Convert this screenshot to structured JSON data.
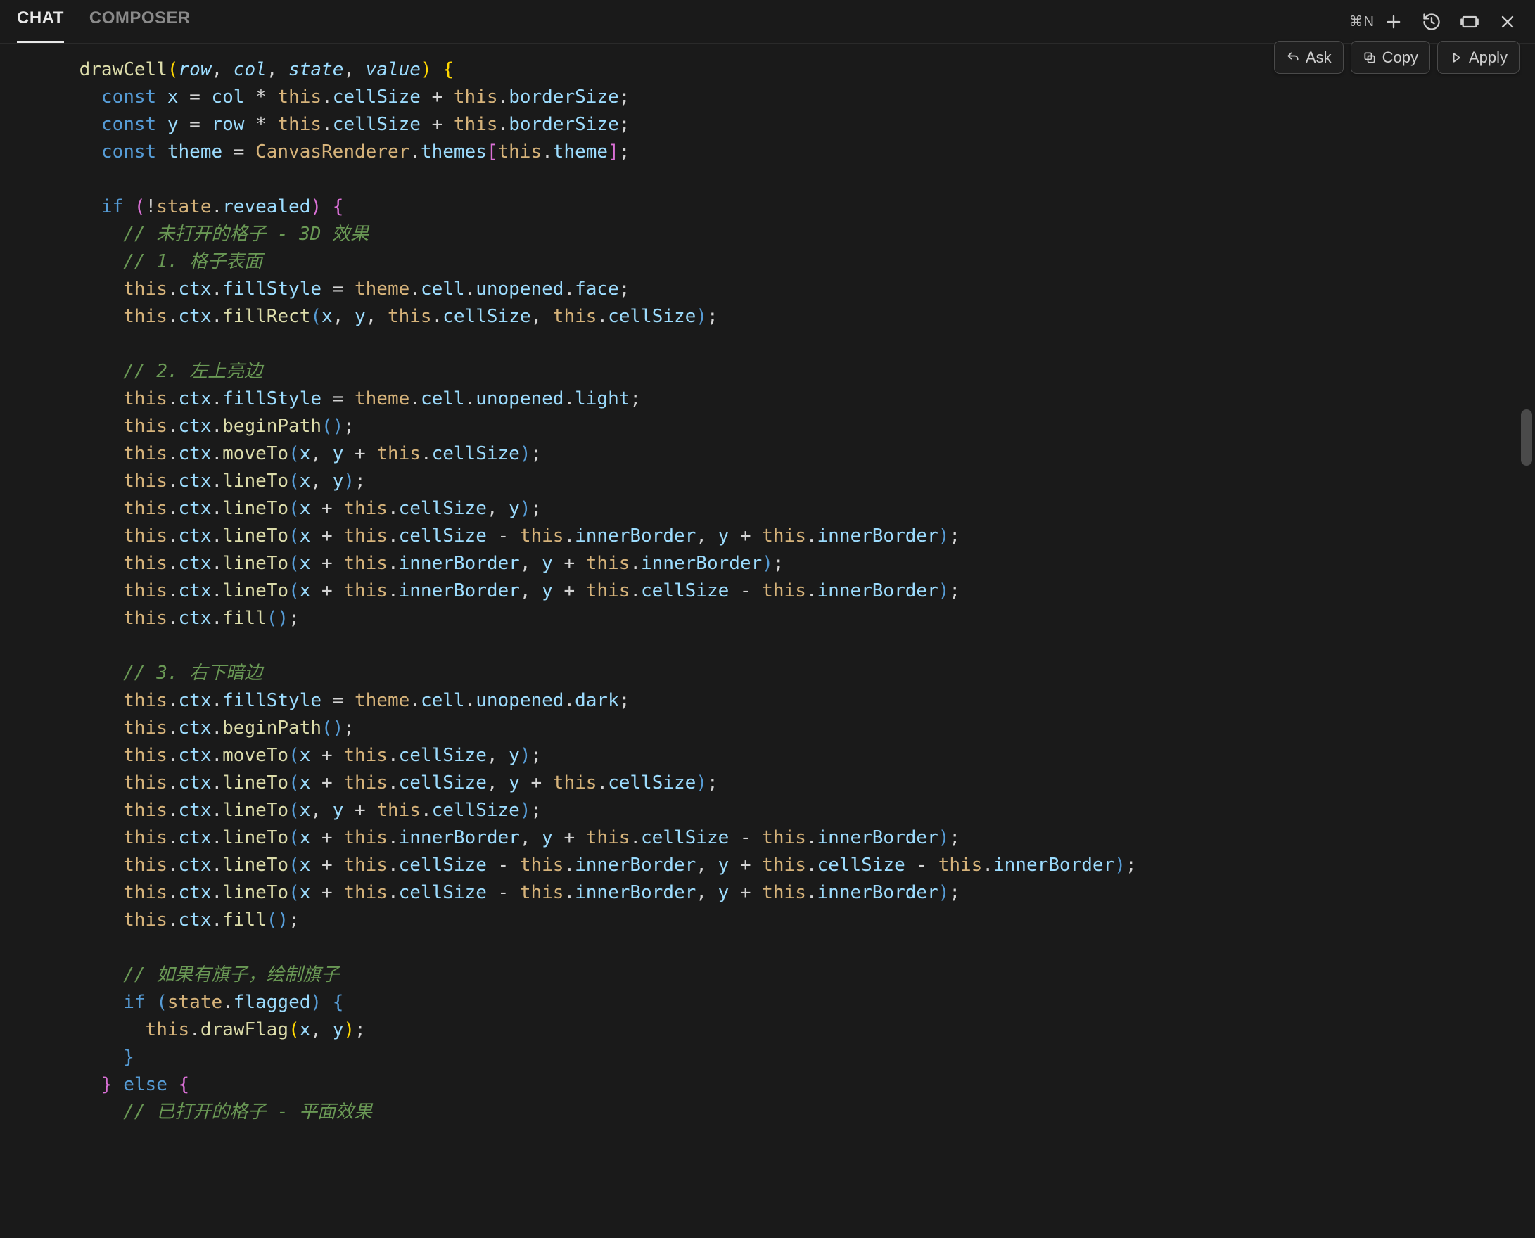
{
  "tabs": {
    "chat": "CHAT",
    "composer": "COMPOSER"
  },
  "shortcut": "⌘N",
  "pills": {
    "ask": "Ask",
    "copy": "Copy",
    "apply": "Apply"
  },
  "code": {
    "sig": {
      "name": "drawCell",
      "p1": "row",
      "p2": "col",
      "p3": "state",
      "p4": "value"
    },
    "c_x": "const x = col * this.cellSize + this.borderSize;",
    "c_y": "const y = row * this.cellSize + this.borderSize;",
    "c_theme": "const theme = CanvasRenderer.themes[this.theme];",
    "if_rev": "if (!state.revealed) {",
    "cmt_unopen": "// 未打开的格子 - 3D 效果",
    "cmt_face": "// 1. 格子表面",
    "l_face1": "this.ctx.fillStyle = theme.cell.unopened.face;",
    "l_face2": "this.ctx.fillRect(x, y, this.cellSize, this.cellSize);",
    "cmt_light": "// 2. 左上亮边",
    "l_lt1": "this.ctx.fillStyle = theme.cell.unopened.light;",
    "l_lt2": "this.ctx.beginPath();",
    "l_lt3": "this.ctx.moveTo(x, y + this.cellSize);",
    "l_lt4": "this.ctx.lineTo(x, y);",
    "l_lt5": "this.ctx.lineTo(x + this.cellSize, y);",
    "l_lt6": "this.ctx.lineTo(x + this.cellSize - this.innerBorder, y + this.innerBorder);",
    "l_lt7": "this.ctx.lineTo(x + this.innerBorder, y + this.innerBorder);",
    "l_lt8": "this.ctx.lineTo(x + this.innerBorder, y + this.cellSize - this.innerBorder);",
    "l_lt9": "this.ctx.fill();",
    "cmt_dark": "// 3. 右下暗边",
    "l_dk1": "this.ctx.fillStyle = theme.cell.unopened.dark;",
    "l_dk2": "this.ctx.beginPath();",
    "l_dk3": "this.ctx.moveTo(x + this.cellSize, y);",
    "l_dk4": "this.ctx.lineTo(x + this.cellSize, y + this.cellSize);",
    "l_dk5": "this.ctx.lineTo(x, y + this.cellSize);",
    "l_dk6": "this.ctx.lineTo(x + this.innerBorder, y + this.cellSize - this.innerBorder);",
    "l_dk7": "this.ctx.lineTo(x + this.cellSize - this.innerBorder, y + this.cellSize - this.innerBorder);",
    "l_dk8": "this.ctx.lineTo(x + this.cellSize - this.innerBorder, y + this.innerBorder);",
    "l_dk9": "this.ctx.fill();",
    "cmt_flag": "// 如果有旗子，绘制旗子",
    "if_flag": "if (state.flagged) {",
    "l_flag": "this.drawFlag(x, y);",
    "close_flag": "}",
    "else_open": "} else {",
    "cmt_open": "// 已打开的格子 - 平面效果"
  }
}
